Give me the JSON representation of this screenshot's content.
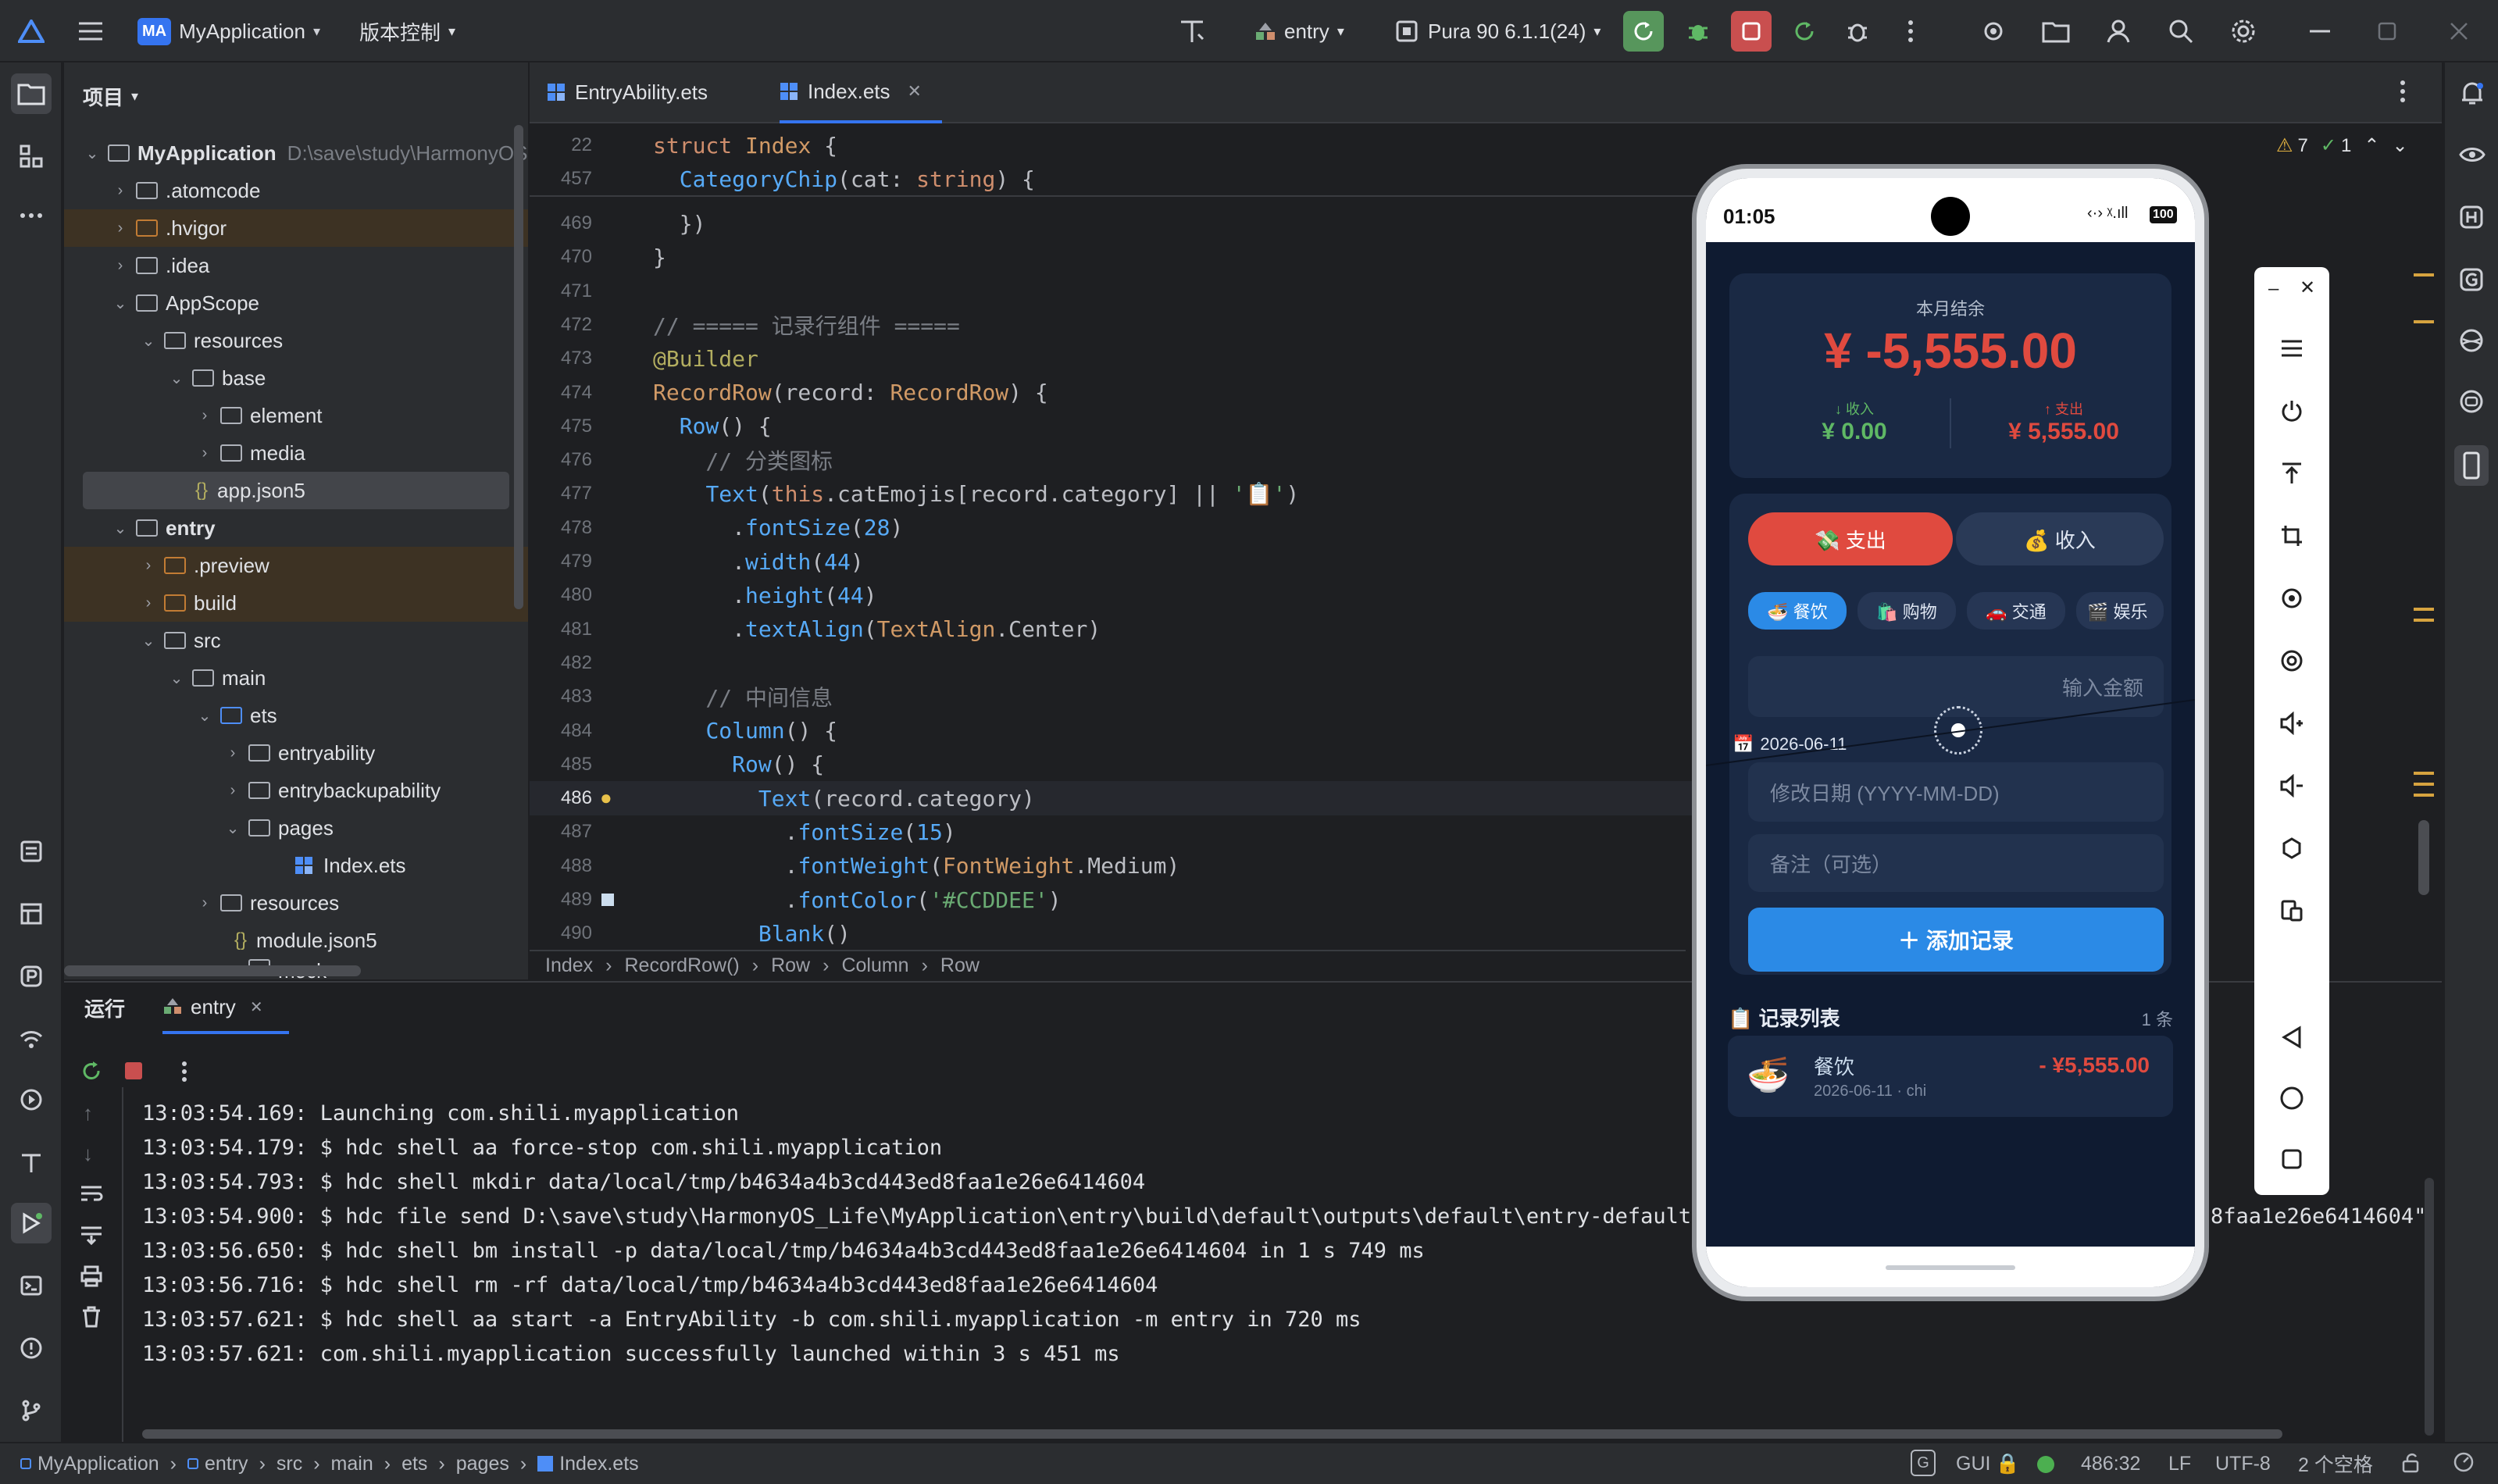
{
  "titlebar": {
    "app_badge": "MA",
    "project_name": "MyApplication",
    "vcs_menu": "版本控制",
    "run_config": "entry",
    "device": "Pura 90 6.1.1(24)"
  },
  "project_panel": {
    "title": "项目",
    "root_name": "MyApplication",
    "root_path": "D:\\save\\study\\HarmonyOS",
    "items": [
      {
        "label": ".atomcode"
      },
      {
        "label": ".hvigor"
      },
      {
        "label": ".idea"
      },
      {
        "label": "AppScope"
      },
      {
        "label": "resources"
      },
      {
        "label": "base"
      },
      {
        "label": "element"
      },
      {
        "label": "media"
      },
      {
        "label": "app.json5"
      },
      {
        "label": "entry"
      },
      {
        "label": ".preview"
      },
      {
        "label": "build"
      },
      {
        "label": "src"
      },
      {
        "label": "main"
      },
      {
        "label": "ets"
      },
      {
        "label": "entryability"
      },
      {
        "label": "entrybackupability"
      },
      {
        "label": "pages"
      },
      {
        "label": "Index.ets"
      },
      {
        "label": "resources"
      },
      {
        "label": "module.json5"
      },
      {
        "label": "mock"
      }
    ]
  },
  "editor": {
    "tabs": [
      {
        "label": "EntryAbility.ets"
      },
      {
        "label": "Index.ets"
      }
    ],
    "inspections": {
      "warnings": "7",
      "ok": "1"
    },
    "sticky": [
      {
        "num": "22",
        "text": "struct Index {"
      },
      {
        "num": "457",
        "text": "CategoryChip(cat: string) {"
      }
    ],
    "lines": [
      {
        "num": "469",
        "text": "  })"
      },
      {
        "num": "470",
        "text": "}"
      },
      {
        "num": "471",
        "text": ""
      },
      {
        "num": "472",
        "text": "// ===== 记录行组件 ====="
      },
      {
        "num": "473",
        "text": "@Builder"
      },
      {
        "num": "474",
        "text": "RecordRow(record: RecordRow) {"
      },
      {
        "num": "475",
        "text": "  Row() {"
      },
      {
        "num": "476",
        "text": "    // 分类图标"
      },
      {
        "num": "477",
        "text": "    Text(this.catEmojis[record.category] || '📋')"
      },
      {
        "num": "478",
        "text": "      .fontSize(28)"
      },
      {
        "num": "479",
        "text": "      .width(44)"
      },
      {
        "num": "480",
        "text": "      .height(44)"
      },
      {
        "num": "481",
        "text": "      .textAlign(TextAlign.Center)"
      },
      {
        "num": "482",
        "text": ""
      },
      {
        "num": "483",
        "text": "    // 中间信息"
      },
      {
        "num": "484",
        "text": "    Column() {"
      },
      {
        "num": "485",
        "text": "      Row() {"
      },
      {
        "num": "486",
        "text": "        Text(record.category)"
      },
      {
        "num": "487",
        "text": "          .fontSize(15)"
      },
      {
        "num": "488",
        "text": "          .fontWeight(FontWeight.Medium)"
      },
      {
        "num": "489",
        "text": "          .fontColor('#CCDDEE')"
      },
      {
        "num": "490",
        "text": "        Blank()"
      }
    ],
    "breadcrumb": [
      "Index",
      "RecordRow()",
      "Row",
      "Column",
      "Row"
    ]
  },
  "run_panel": {
    "title": "运行",
    "tab": "entry",
    "logs": [
      "13:03:54.169: Launching com.shili.myapplication",
      "13:03:54.179: $ hdc shell aa force-stop com.shili.myapplication",
      "13:03:54.793: $ hdc shell mkdir data/local/tmp/b4634a4b3cd443ed8faa1e26e6414604",
      "13:03:54.900: $ hdc file send D:\\save\\study\\HarmonyOS_Life\\MyApplication\\entry\\build\\default\\outputs\\default\\entry-default-s",
      "13:03:56.650: $ hdc shell bm install -p data/local/tmp/b4634a4b3cd443ed8faa1e26e6414604 in 1 s 749 ms",
      "13:03:56.716: $ hdc shell rm -rf data/local/tmp/b4634a4b3cd443ed8faa1e26e6414604",
      "13:03:57.621: $ hdc shell aa start -a EntryAbility -b com.shili.myapplication -m entry in 720 ms",
      "13:03:57.621: com.shili.myapplication successfully launched within 3 s 451 ms"
    ],
    "log_tail": "8faa1e26e6414604\""
  },
  "status_bar": {
    "crumbs": [
      "MyApplication",
      "entry",
      "src",
      "main",
      "ets",
      "pages",
      "Index.ets"
    ],
    "gui": "GUI",
    "position": "486:32",
    "line_ending": "LF",
    "encoding": "UTF-8",
    "indent": "2 个空格"
  },
  "phone": {
    "time": "01:05",
    "battery": "100",
    "summary_title": "本月结余",
    "balance": "¥ -5,555.00",
    "income_label": "↓ 收入",
    "income_value": "¥ 0.00",
    "expense_label": "↑ 支出",
    "expense_value": "¥ 5,555.00",
    "btn_expense": "💸 支出",
    "btn_income": "💰 收入",
    "categories": [
      "🍜 餐饮",
      "🛍️ 购物",
      "🚗 交通",
      "🎬 娱乐"
    ],
    "amount_placeholder": "输入金额",
    "date_value": "2026-06-11",
    "date_placeholder": "修改日期 (YYYY-MM-DD)",
    "note_placeholder": "备注（可选）",
    "add_button": "＋ 添加记录",
    "list_title": "📋 记录列表",
    "list_count": "1 条",
    "record": {
      "emoji": "🍜",
      "category": "餐饮",
      "meta": "2026-06-11 · chi",
      "amount": "- ¥5,555.00"
    }
  },
  "colors": {
    "accent_red": "#e04a3f",
    "accent_blue": "#2b8ae6",
    "ide_bg": "#1e1f22",
    "panel_bg": "#2b2d30",
    "run_green": "#4caf50"
  }
}
